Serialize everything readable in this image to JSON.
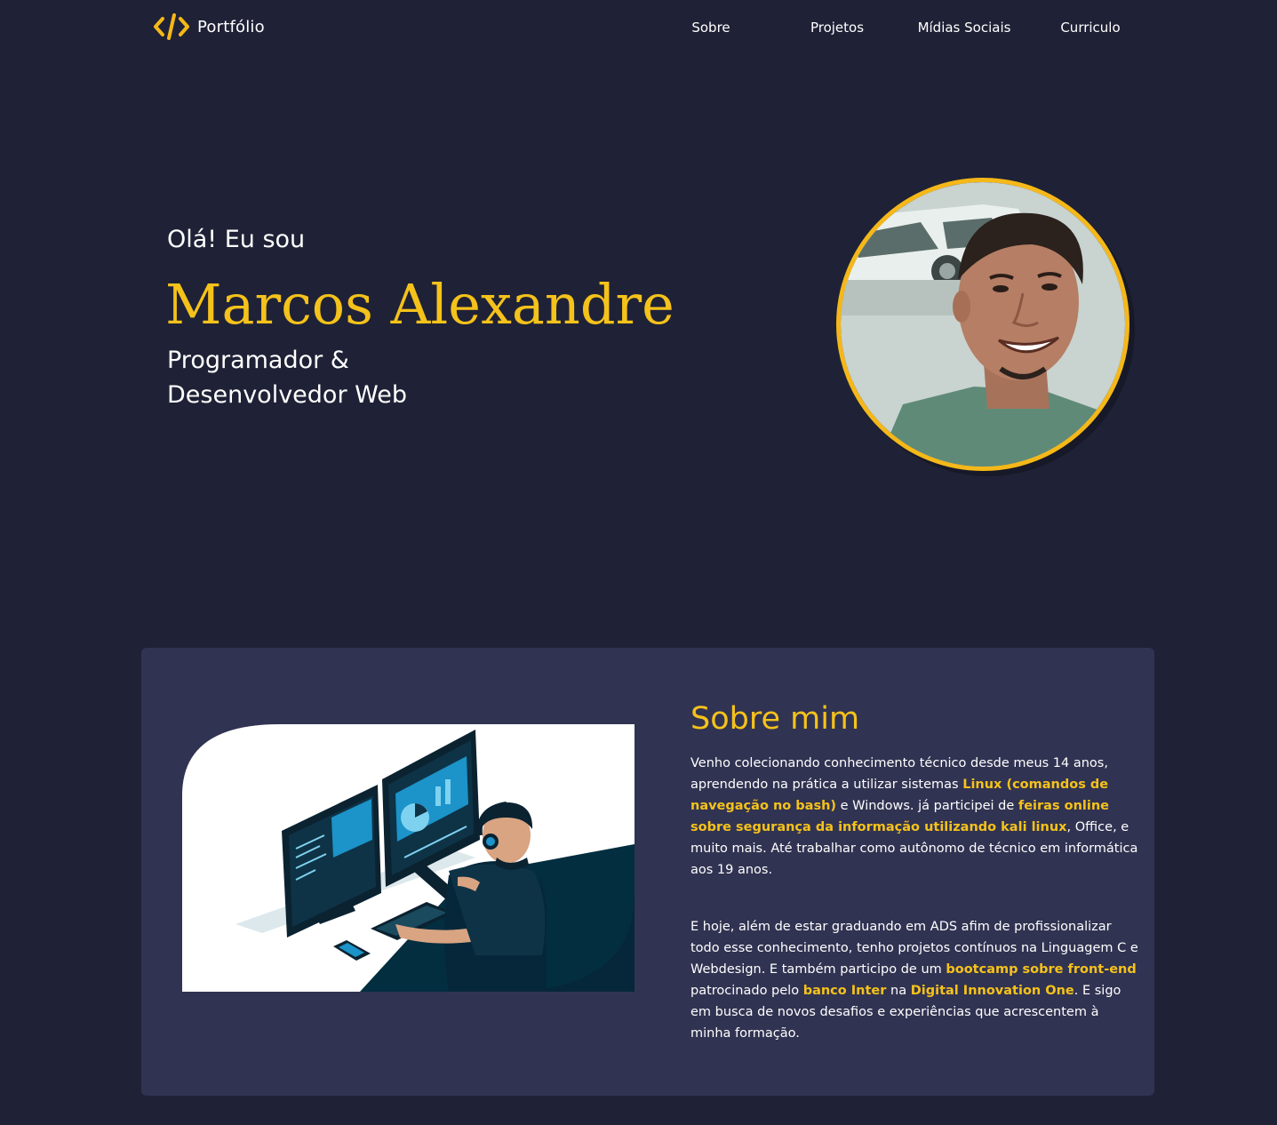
{
  "nav": {
    "logo_text": "Portfólio",
    "links": [
      "Sobre",
      "Projetos",
      "Mídias Sociais",
      "Curriculo"
    ]
  },
  "hero": {
    "greeting": "Olá! Eu sou",
    "name": "Marcos Alexandre",
    "role_line1": "Programador &",
    "role_line2": "Desenvolvedor Web"
  },
  "about": {
    "title": "Sobre mim",
    "p1": {
      "t1": "Venho colecionando conhecimento técnico desde meus 14 anos, aprendendo na prática a utilizar sistemas ",
      "h1": "Linux (comandos de navegação no bash)",
      "t2": " e Windows. já participei de ",
      "h2": "feiras online sobre segurança da informação utilizando kali linux",
      "t3": ", Office, e muito mais. Até trabalhar como autônomo de técnico em informática aos 19 anos."
    },
    "p2": {
      "t1": "E hoje, além de estar graduando em ADS afim de profissionalizar todo esse conhecimento, tenho projetos contínuos na Linguagem C e Webdesign. E também participo de um ",
      "h1": "bootcamp sobre front-end",
      "t2": " patrocinado pelo ",
      "h2": "banco Inter",
      "t3": " na ",
      "h3": "Digital Innovation One",
      "t4": ". E sigo em busca de novos desafios e experiências que acrescentem à minha formação."
    }
  },
  "colors": {
    "background": "#1f2236",
    "card": "#313352",
    "accent": "#f5c21b",
    "text": "#ffffff"
  },
  "icons": {
    "logo": "code-brackets-icon"
  }
}
